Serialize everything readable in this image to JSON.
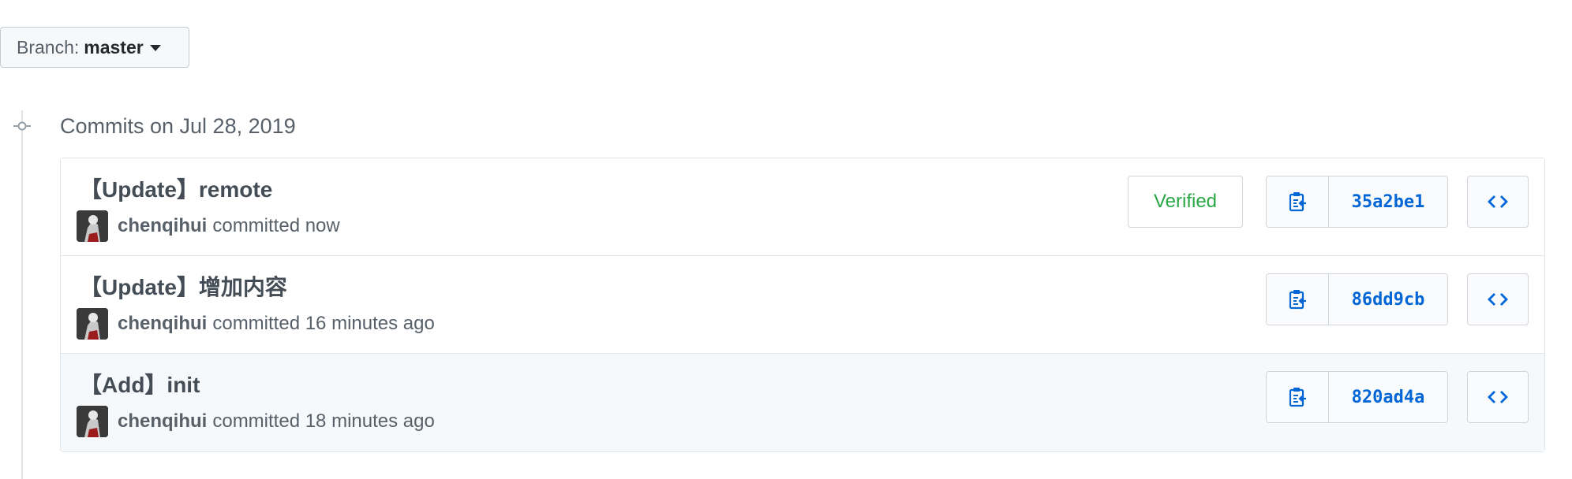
{
  "branch": {
    "prefix": "Branch:",
    "name": "master",
    "caret_icon": "caret-down-icon"
  },
  "commit_group": {
    "title": "Commits on Jul 28, 2019"
  },
  "commits": [
    {
      "title": "【Update】remote",
      "author": "chenqihui",
      "action_time": "committed now",
      "verified": "Verified",
      "sha": "35a2be1",
      "highlight": false
    },
    {
      "title": "【Update】增加内容",
      "author": "chenqihui",
      "action_time": "committed 16 minutes ago",
      "verified": "",
      "sha": "86dd9cb",
      "highlight": false
    },
    {
      "title": "【Add】init",
      "author": "chenqihui",
      "action_time": "committed 18 minutes ago",
      "verified": "",
      "sha": "820ad4a",
      "highlight": true
    }
  ],
  "icons": {
    "copy": "clipboard-icon",
    "browse": "code-icon",
    "timeline": "commit-node-icon"
  },
  "colors": {
    "link": "#0366d6",
    "verified": "#28a745",
    "border": "#e1e4e8",
    "highlight_bg": "#f6f9fc"
  }
}
